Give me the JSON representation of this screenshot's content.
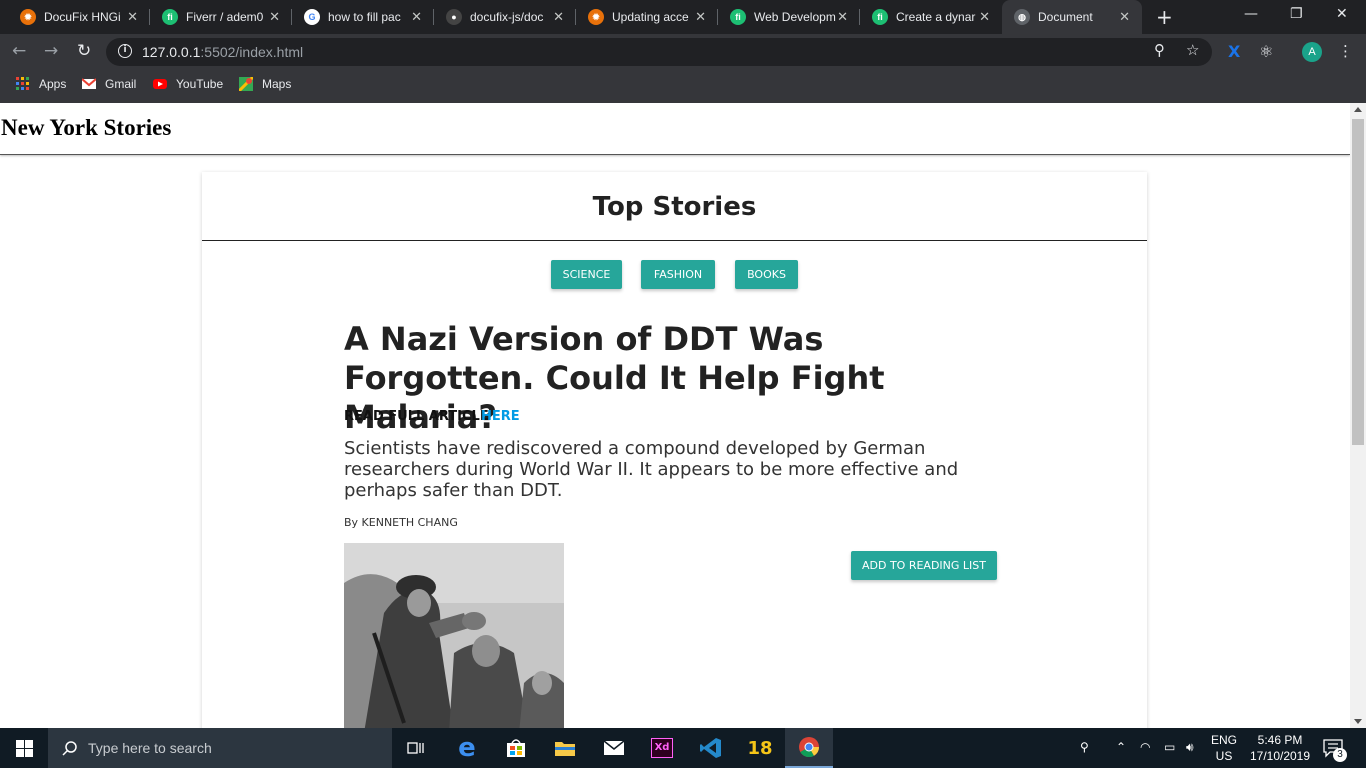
{
  "browser": {
    "tabs": [
      {
        "title": "DocuFix HNGi",
        "favicon": "docufix-icon",
        "color": "#e8710a"
      },
      {
        "title": "Fiverr / adem0",
        "favicon": "fiverr-icon",
        "color": "#1dbf73"
      },
      {
        "title": "how to fill pac",
        "favicon": "google-icon",
        "color": "#4285f4"
      },
      {
        "title": "docufix-js/doc",
        "favicon": "github-icon",
        "color": "#444444"
      },
      {
        "title": "Updating acce",
        "favicon": "docufix-icon",
        "color": "#e8710a"
      },
      {
        "title": "Web Developm",
        "favicon": "fiverr-icon",
        "color": "#1dbf73"
      },
      {
        "title": "Create a dynar",
        "favicon": "fiverr-icon",
        "color": "#1dbf73"
      },
      {
        "title": "Document",
        "favicon": "globe-icon",
        "color": "#5f6368"
      }
    ],
    "active_tab": 7,
    "url_host": "127.0.0.1",
    "url_rest": ":5502/index.html",
    "bookmarks": [
      {
        "label": "Apps",
        "icon": "apps-grid-icon"
      },
      {
        "label": "Gmail",
        "icon": "gmail-icon"
      },
      {
        "label": "YouTube",
        "icon": "youtube-icon"
      },
      {
        "label": "Maps",
        "icon": "maps-icon"
      }
    ],
    "profile_initial": "A",
    "window_controls": {
      "minimize": "—",
      "maximize": "❐",
      "close": "✕"
    }
  },
  "page": {
    "site_title": "New York Stories",
    "section_title": "Top Stories",
    "categories": [
      "SCIENCE",
      "FASHION",
      "BOOKS"
    ],
    "accent_color": "#26a69a",
    "link_color": "#039be5",
    "article": {
      "headline": "A Nazi Version of DDT Was Forgotten. Could It Help Fight Malaria?",
      "read_full_label": "READ FULL ARTICLE",
      "read_full_link": "HERE",
      "abstract": "Scientists have rediscovered a compound developed by German researchers during World War II. It appears to be more effective and perhaps safer than DDT.",
      "byline": "By KENNETH CHANG",
      "add_button": "ADD TO READING LIST"
    }
  },
  "taskbar": {
    "search_placeholder": "Type here to search",
    "apps": [
      "task-view-icon",
      "edge-icon",
      "store-icon",
      "file-explorer-icon",
      "mail-icon",
      "adobe-xd-icon",
      "vscode-icon",
      "app-18-icon",
      "chrome-icon"
    ],
    "lang_line1": "ENG",
    "lang_line2": "US",
    "time": "5:46 PM",
    "date": "17/10/2019",
    "notification_count": "3"
  }
}
